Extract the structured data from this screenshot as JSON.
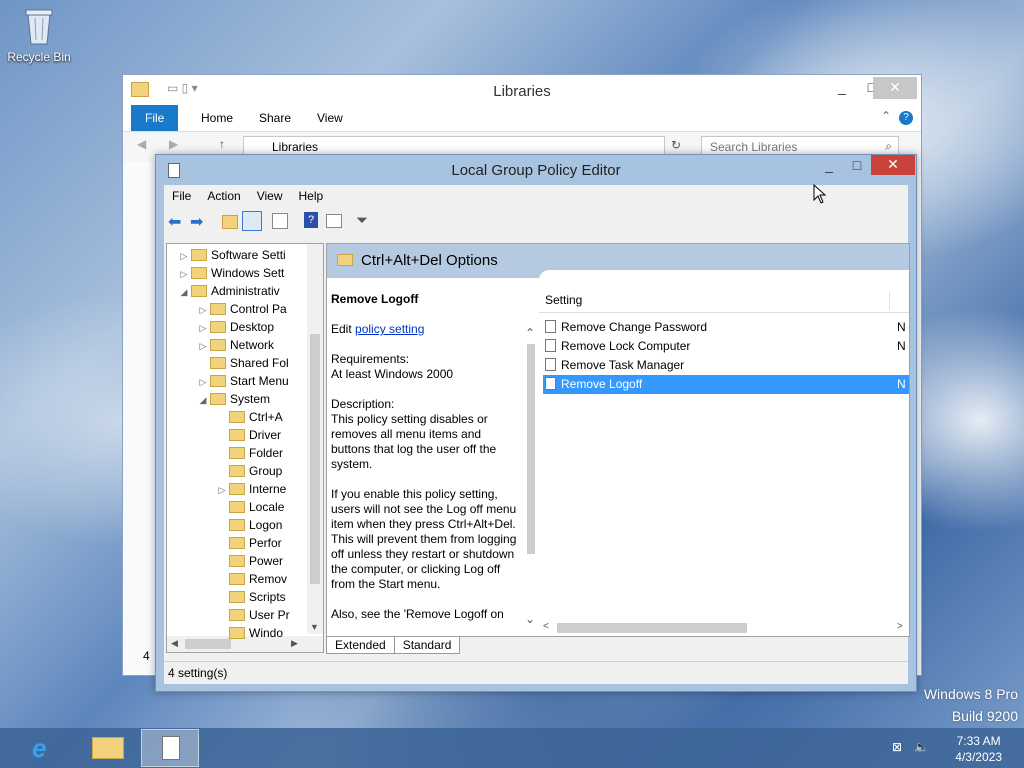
{
  "desktop": {
    "recycle_bin": "Recycle Bin",
    "watermark_line1": "Windows 8 Pro",
    "watermark_line2": "Build 9200"
  },
  "explorer": {
    "title": "Libraries",
    "tabs": [
      "File",
      "Home",
      "Share",
      "View"
    ],
    "address": "Libraries",
    "search_placeholder": "Search Libraries",
    "status_count": "4"
  },
  "gpe": {
    "title": "Local Group Policy Editor",
    "menu": [
      "File",
      "Action",
      "View",
      "Help"
    ],
    "tree": [
      {
        "label": "Software Setti",
        "indent": 0,
        "arrow": "▷"
      },
      {
        "label": "Windows Sett",
        "indent": 0,
        "arrow": "▷"
      },
      {
        "label": "Administrativ",
        "indent": 0,
        "arrow": "◢"
      },
      {
        "label": "Control Pa",
        "indent": 1,
        "arrow": "▷"
      },
      {
        "label": "Desktop",
        "indent": 1,
        "arrow": "▷"
      },
      {
        "label": "Network",
        "indent": 1,
        "arrow": "▷"
      },
      {
        "label": "Shared Fol",
        "indent": 1,
        "arrow": ""
      },
      {
        "label": "Start Menu",
        "indent": 1,
        "arrow": "▷"
      },
      {
        "label": "System",
        "indent": 1,
        "arrow": "◢"
      },
      {
        "label": "Ctrl+A",
        "indent": 2,
        "arrow": ""
      },
      {
        "label": "Driver",
        "indent": 2,
        "arrow": ""
      },
      {
        "label": "Folder",
        "indent": 2,
        "arrow": ""
      },
      {
        "label": "Group",
        "indent": 2,
        "arrow": ""
      },
      {
        "label": "Interne",
        "indent": 2,
        "arrow": "▷"
      },
      {
        "label": "Locale",
        "indent": 2,
        "arrow": ""
      },
      {
        "label": "Logon",
        "indent": 2,
        "arrow": ""
      },
      {
        "label": "Perfor",
        "indent": 2,
        "arrow": ""
      },
      {
        "label": "Power",
        "indent": 2,
        "arrow": ""
      },
      {
        "label": "Remov",
        "indent": 2,
        "arrow": ""
      },
      {
        "label": "Scripts",
        "indent": 2,
        "arrow": ""
      },
      {
        "label": "User Pr",
        "indent": 2,
        "arrow": ""
      },
      {
        "label": "Windo",
        "indent": 2,
        "arrow": ""
      }
    ],
    "pane_title": "Ctrl+Alt+Del Options",
    "desc": {
      "heading": "Remove Logoff",
      "edit_prefix": "Edit ",
      "edit_link": "policy setting ",
      "req_label": "Requirements:",
      "req_value": "At least Windows 2000",
      "desc_label": "Description:",
      "desc_text": "This policy setting disables or removes all menu items and buttons that log the user off the system.",
      "enable_text": "If you enable this policy setting, users will not see the Log off menu item when they press Ctrl+Alt+Del. This will prevent them from logging off unless they restart or shutdown the computer, or clicking Log off from the Start menu.",
      "also_text": "Also, see the 'Remove Logoff on"
    },
    "list_header": "Setting",
    "settings": [
      {
        "name": "Remove Change Password",
        "state": "N"
      },
      {
        "name": "Remove Lock Computer",
        "state": "N"
      },
      {
        "name": "Remove Task Manager",
        "state": ""
      },
      {
        "name": "Remove Logoff",
        "state": "N"
      }
    ],
    "selected_index": 3,
    "view_tabs": [
      "Extended",
      "Standard"
    ],
    "status": "4 setting(s)"
  },
  "taskbar": {
    "time": "7:33 AM",
    "date": "4/3/2023"
  },
  "colors": {
    "selection": "#3399ff",
    "close_red": "#c9433a",
    "file_tab": "#1979ca",
    "link": "#0033cc"
  }
}
